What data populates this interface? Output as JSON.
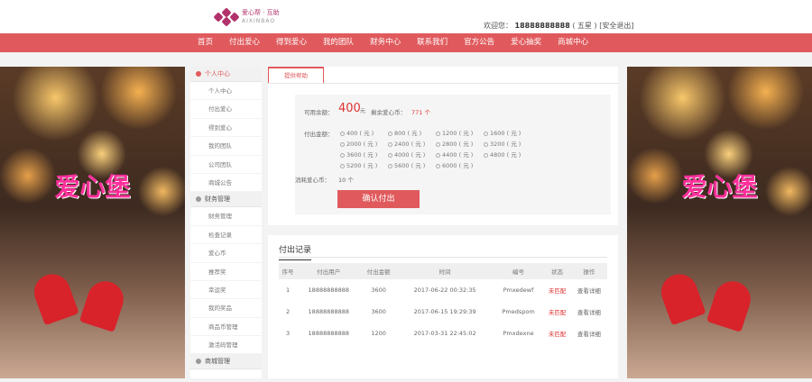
{
  "header": {
    "logo_cn": "爱心帮 · 互助",
    "logo_en": "AIXINBAO",
    "welcome_prefix": "欢迎您：",
    "phone": "18888888888",
    "tag": "( 五星 )",
    "logout": "[安全退出]"
  },
  "nav": [
    "首页",
    "付出爱心",
    "得到爱心",
    "我的团队",
    "财务中心",
    "联系我们",
    "官方公告",
    "爱心抽奖",
    "商城中心"
  ],
  "background": {
    "logo": "爱心堡"
  },
  "sidebar": {
    "groups": [
      {
        "title": "个人中心",
        "items": [
          "个人中心",
          "付出爱心",
          "得到爱心",
          "我的团队",
          "公司团队",
          "商城公告"
        ]
      },
      {
        "title": "财务管理",
        "items": [
          "财务管理",
          "检查记录",
          "爱心币",
          "推荐奖",
          "幸运奖",
          "我的奖品",
          "商品币管理",
          "激活码管理"
        ]
      },
      {
        "title": "商城管理",
        "items": []
      }
    ]
  },
  "main": {
    "tab": "提供帮助",
    "available_label": "可用余额：",
    "available_value": "400",
    "available_unit": "元",
    "coin_label": "剩余爱心币：",
    "coin_value": "771 个",
    "amount_label": "付出金额：",
    "options": [
      "400 ( 元 )",
      "800 ( 元 )",
      "1200 ( 元 )",
      "1600 ( 元 )",
      "2000 ( 元 )",
      "2400 ( 元 )",
      "2800 ( 元 )",
      "3200 ( 元 )",
      "3600 ( 元 )",
      "4000 ( 元 )",
      "4400 ( 元 )",
      "4800 ( 元 )",
      "5200 ( 元 )",
      "5600 ( 元 )",
      "6000 ( 元 )"
    ],
    "consume_label": "消耗爱心币：",
    "consume_value": "10 个",
    "confirm": "确认付出"
  },
  "records": {
    "title": "付出记录",
    "columns": [
      "序号",
      "付出用户",
      "付出金额",
      "时间",
      "编号",
      "状态",
      "操作"
    ],
    "rows": [
      [
        "1",
        "18888888888",
        "3600",
        "2017-06-22 00:32:35",
        "Pmxedewf",
        "未匹配",
        "查看详细"
      ],
      [
        "2",
        "18888888888",
        "3600",
        "2017-06-15 19:29:39",
        "Pmedspom",
        "未匹配",
        "查看详细"
      ],
      [
        "3",
        "18888888888",
        "1200",
        "2017-03-31 22:45:02",
        "Pmxdexne",
        "未匹配",
        "查看详细"
      ]
    ]
  },
  "colors": {
    "accent": "#e05a5d",
    "status": "#e03030"
  }
}
